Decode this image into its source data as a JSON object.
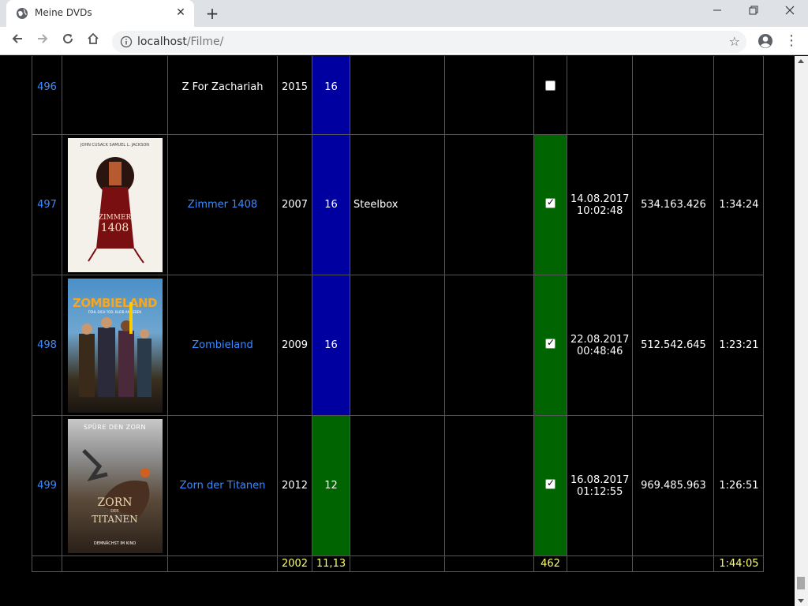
{
  "browser": {
    "tab_title": "Meine DVDs",
    "url_host": "localhost",
    "url_path": "/Filme/",
    "new_tab_label": "+",
    "close_label": "✕"
  },
  "rows": [
    {
      "num": "496",
      "title": "Z For Zachariah",
      "year": "2015",
      "fsk": "16",
      "edition": "",
      "checked": false,
      "date": "",
      "time_stamp": "",
      "size": "",
      "duration": ""
    },
    {
      "num": "497",
      "title": "Zimmer 1408",
      "year": "2007",
      "fsk": "16",
      "edition": "Steelbox",
      "checked": true,
      "date": "14.08.2017",
      "time_stamp": "10:02:48",
      "size": "534.163.426",
      "duration": "1:34:24"
    },
    {
      "num": "498",
      "title": "Zombieland",
      "year": "2009",
      "fsk": "16",
      "edition": "",
      "checked": true,
      "date": "22.08.2017",
      "time_stamp": "00:48:46",
      "size": "512.542.645",
      "duration": "1:23:21"
    },
    {
      "num": "499",
      "title": "Zorn der Titanen",
      "year": "2012",
      "fsk": "12",
      "edition": "",
      "checked": true,
      "date": "16.08.2017",
      "time_stamp": "01:12:55",
      "size": "969.485.963",
      "duration": "1:26:51"
    }
  ],
  "posters": {
    "p497": {
      "top_names": "JOHN CUSACK   SAMUEL L. JACKSON",
      "title_a": "ZIMMER",
      "title_b": "1408"
    },
    "p498": {
      "title": "ZOMBIELAND",
      "tagline": "FÜHL DICH TOD, BLEIB AM LEBEN"
    },
    "p499": {
      "top": "SPÜRE DEN ZORN",
      "title_a": "ZORN",
      "title_b": "DER",
      "title_c": "TITANEN",
      "bottom": "DEMNÄCHST IM KINO"
    }
  },
  "summary": {
    "year": "2002",
    "fsk": "11,13",
    "count": "462",
    "duration": "1:44:05"
  },
  "colors": {
    "link": "#3d8bff",
    "fsk_blue": "#0000a0",
    "green": "#006400",
    "summary_text": "#ffff66"
  }
}
